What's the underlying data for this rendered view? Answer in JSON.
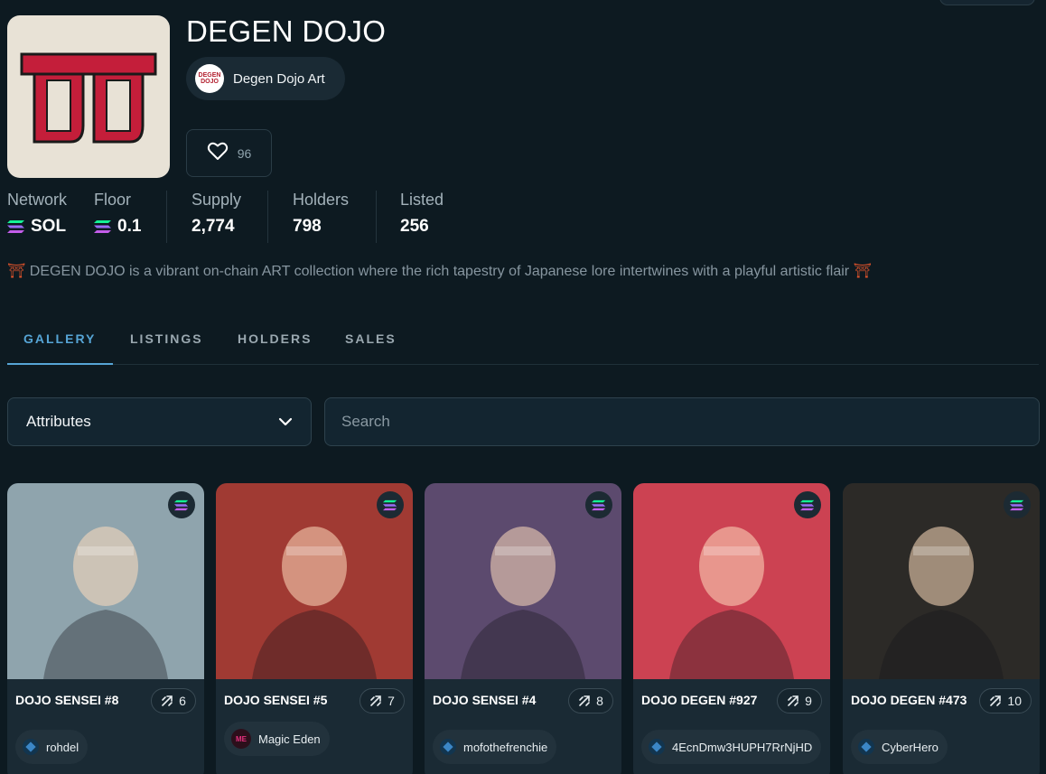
{
  "collection": {
    "title": "DEGEN DOJO",
    "creator": "Degen Dojo Art",
    "creator_avatar_text": "DEGEN DOJO",
    "likes": "96",
    "description_text": "DEGEN DOJO is a vibrant on-chain ART collection where the rich tapestry of Japanese lore intertwines with a playful artistic flair",
    "description_emoji": "⛩"
  },
  "stats": [
    {
      "label": "Network",
      "value": "SOL",
      "icon": "solana-icon"
    },
    {
      "label": "Floor",
      "value": "0.1",
      "icon": "solana-icon"
    },
    {
      "label": "Supply",
      "value": "2,774"
    },
    {
      "label": "Holders",
      "value": "798"
    },
    {
      "label": "Listed",
      "value": "256"
    }
  ],
  "tabs": [
    {
      "label": "GALLERY",
      "active": true
    },
    {
      "label": "LISTINGS",
      "active": false
    },
    {
      "label": "HOLDERS",
      "active": false
    },
    {
      "label": "SALES",
      "active": false
    }
  ],
  "filters": {
    "attributes_label": "Attributes",
    "search_placeholder": "Search"
  },
  "colors": {
    "background": "#0d1a21",
    "accent": "#56a5d6",
    "card": "#1a2a34",
    "brand_red": "#c41e3a"
  },
  "cards": [
    {
      "name": "DOJO SENSEI #8",
      "rank": "6",
      "owner": "rohdel",
      "owner_icon": "wallet-icon",
      "art_bg": "#8fa4ad"
    },
    {
      "name": "DOJO SENSEI #5",
      "rank": "7",
      "owner": "Magic Eden",
      "owner_icon": "magic-eden-icon",
      "art_bg": "#a03a33"
    },
    {
      "name": "DOJO SENSEI #4",
      "rank": "8",
      "owner": "mofothefrenchie",
      "owner_icon": "wallet-icon",
      "art_bg": "#5c4a6e"
    },
    {
      "name": "DOJO DEGEN #927",
      "rank": "9",
      "owner": "4EcnDmw3HUPH7RrNjHD",
      "owner_icon": "wallet-icon",
      "art_bg": "#cc4252"
    },
    {
      "name": "DOJO DEGEN #473",
      "rank": "10",
      "owner": "CyberHero",
      "owner_icon": "wallet-icon",
      "art_bg": "#2c2a27"
    }
  ]
}
